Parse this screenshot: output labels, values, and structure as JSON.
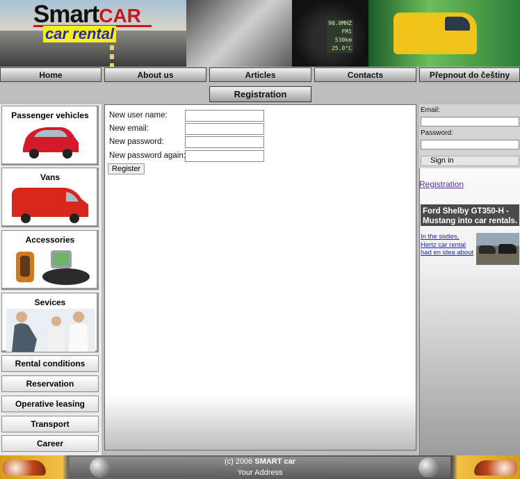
{
  "banner": {
    "brand_main": "Smart",
    "brand_car": "CAR",
    "brand_sub": "car rental",
    "dash_lines": [
      "90.0MHZ",
      "FM1",
      "530km",
      "25.0°C"
    ]
  },
  "nav": {
    "home": "Home",
    "about": "About us",
    "articles": "Articles",
    "contacts": "Contacts",
    "language": "Přepnout do češtiny"
  },
  "page_title": "Registration",
  "sidebar": {
    "passenger": "Passenger vehicles",
    "vans": "Vans",
    "accessories": "Accessories",
    "services": "Sevices",
    "menu": [
      "Rental conditions",
      "Reservation",
      "Operative leasing",
      "Transport",
      "Career"
    ]
  },
  "form": {
    "username_label": "New user name:",
    "email_label": "New email:",
    "password_label": "New password:",
    "password_again_label": "New password again:",
    "username_value": "",
    "email_value": "",
    "password_value": "",
    "password_again_value": "",
    "register_label": "Register"
  },
  "login": {
    "email_label": "Email:",
    "password_label": "Password:",
    "email_value": "",
    "password_value": "",
    "signin_label": "Sign in",
    "registration_link": "Registration"
  },
  "news": {
    "title": "Ford Shelby GT350-H - Mustang into car rentals.",
    "text": "In the sixties, Hertz car rental had en idea about"
  },
  "footer": {
    "copyright_prefix": "(c) 2006 ",
    "copyright_brand": "SMART car",
    "address": "Your Address"
  }
}
